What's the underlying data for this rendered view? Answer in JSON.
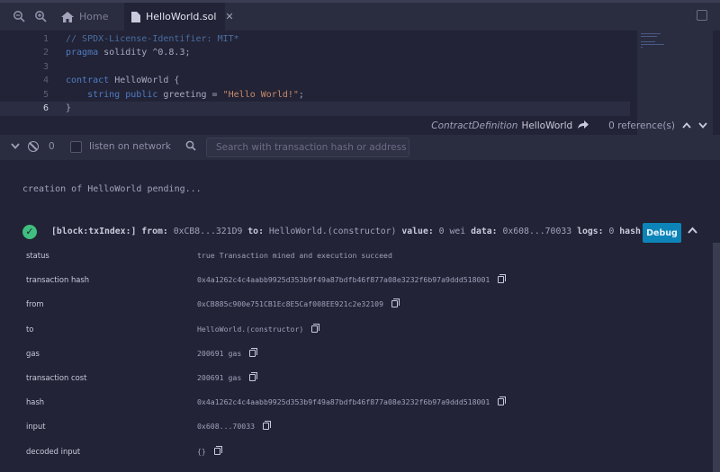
{
  "tabs": {
    "home_label": "Home",
    "file_label": "HelloWorld.sol",
    "close_glyph": "✕"
  },
  "editor": {
    "lines": [
      {
        "n": "1",
        "parts": [
          {
            "t": "// SPDX-License-Identifier: MIT*",
            "c": "comment"
          }
        ]
      },
      {
        "n": "2",
        "parts": [
          {
            "t": "pragma ",
            "c": "kw"
          },
          {
            "t": "solidity ^0.8.3;",
            "c": "ident"
          }
        ]
      },
      {
        "n": "3",
        "parts": []
      },
      {
        "n": "4",
        "parts": [
          {
            "t": "contract ",
            "c": "kw"
          },
          {
            "t": "HelloWorld {",
            "c": "ident"
          }
        ]
      },
      {
        "n": "5",
        "parts": [
          {
            "t": "    string public ",
            "c": "kw"
          },
          {
            "t": "greeting = ",
            "c": "ident"
          },
          {
            "t": "\"Hello World!\"",
            "c": "str"
          },
          {
            "t": ";",
            "c": "ident"
          }
        ]
      },
      {
        "n": "6",
        "parts": [
          {
            "t": "}",
            "c": "ident"
          }
        ]
      }
    ],
    "current_line": "6",
    "definition_label": "ContractDefinition",
    "definition_name": "HelloWorld",
    "references": "0 reference(s)"
  },
  "terminal": {
    "count": "0",
    "listen_label": "listen on network",
    "search_placeholder": "Search with transaction hash or address",
    "pending": "creation of HelloWorld pending...",
    "summary": {
      "block_label": "[block:txIndex:]",
      "from_label": "from:",
      "from_value": "0xCB8...321D9",
      "to_label": "to:",
      "to_value": "HelloWorld.(constructor)",
      "value_label": "value:",
      "value_value": "0 wei",
      "data_label": "data:",
      "data_value": "0x608...70033",
      "logs_label": "logs:",
      "logs_value": "0",
      "hash_label": "hash:"
    },
    "debug_label": "Debug",
    "rows": [
      {
        "key": "status",
        "value": "true Transaction mined and execution succeed",
        "copy": false
      },
      {
        "key": "transaction hash",
        "value": "0x4a1262c4c4aabb9925d353b9f49a87bdfb46f877a08e3232f6b97a9ddd518001",
        "copy": true
      },
      {
        "key": "from",
        "value": "0xCB885c900e751CB1Ec8E5Caf008EE921c2e32109",
        "copy": true
      },
      {
        "key": "to",
        "value": "HelloWorld.(constructor)",
        "copy": true
      },
      {
        "key": "gas",
        "value": "200691 gas",
        "copy": true
      },
      {
        "key": "transaction cost",
        "value": "200691 gas",
        "copy": true
      },
      {
        "key": "hash",
        "value": "0x4a1262c4c4aabb9925d353b9f49a87bdfb46f877a08e3232f6b97a9ddd518001",
        "copy": true
      },
      {
        "key": "input",
        "value": "0x608...70033",
        "copy": true
      },
      {
        "key": "decoded input",
        "value": "{}",
        "copy": true
      }
    ]
  },
  "colors": {
    "background": "#222336",
    "accent": "#0d84b8",
    "success": "#3fbf7f"
  }
}
